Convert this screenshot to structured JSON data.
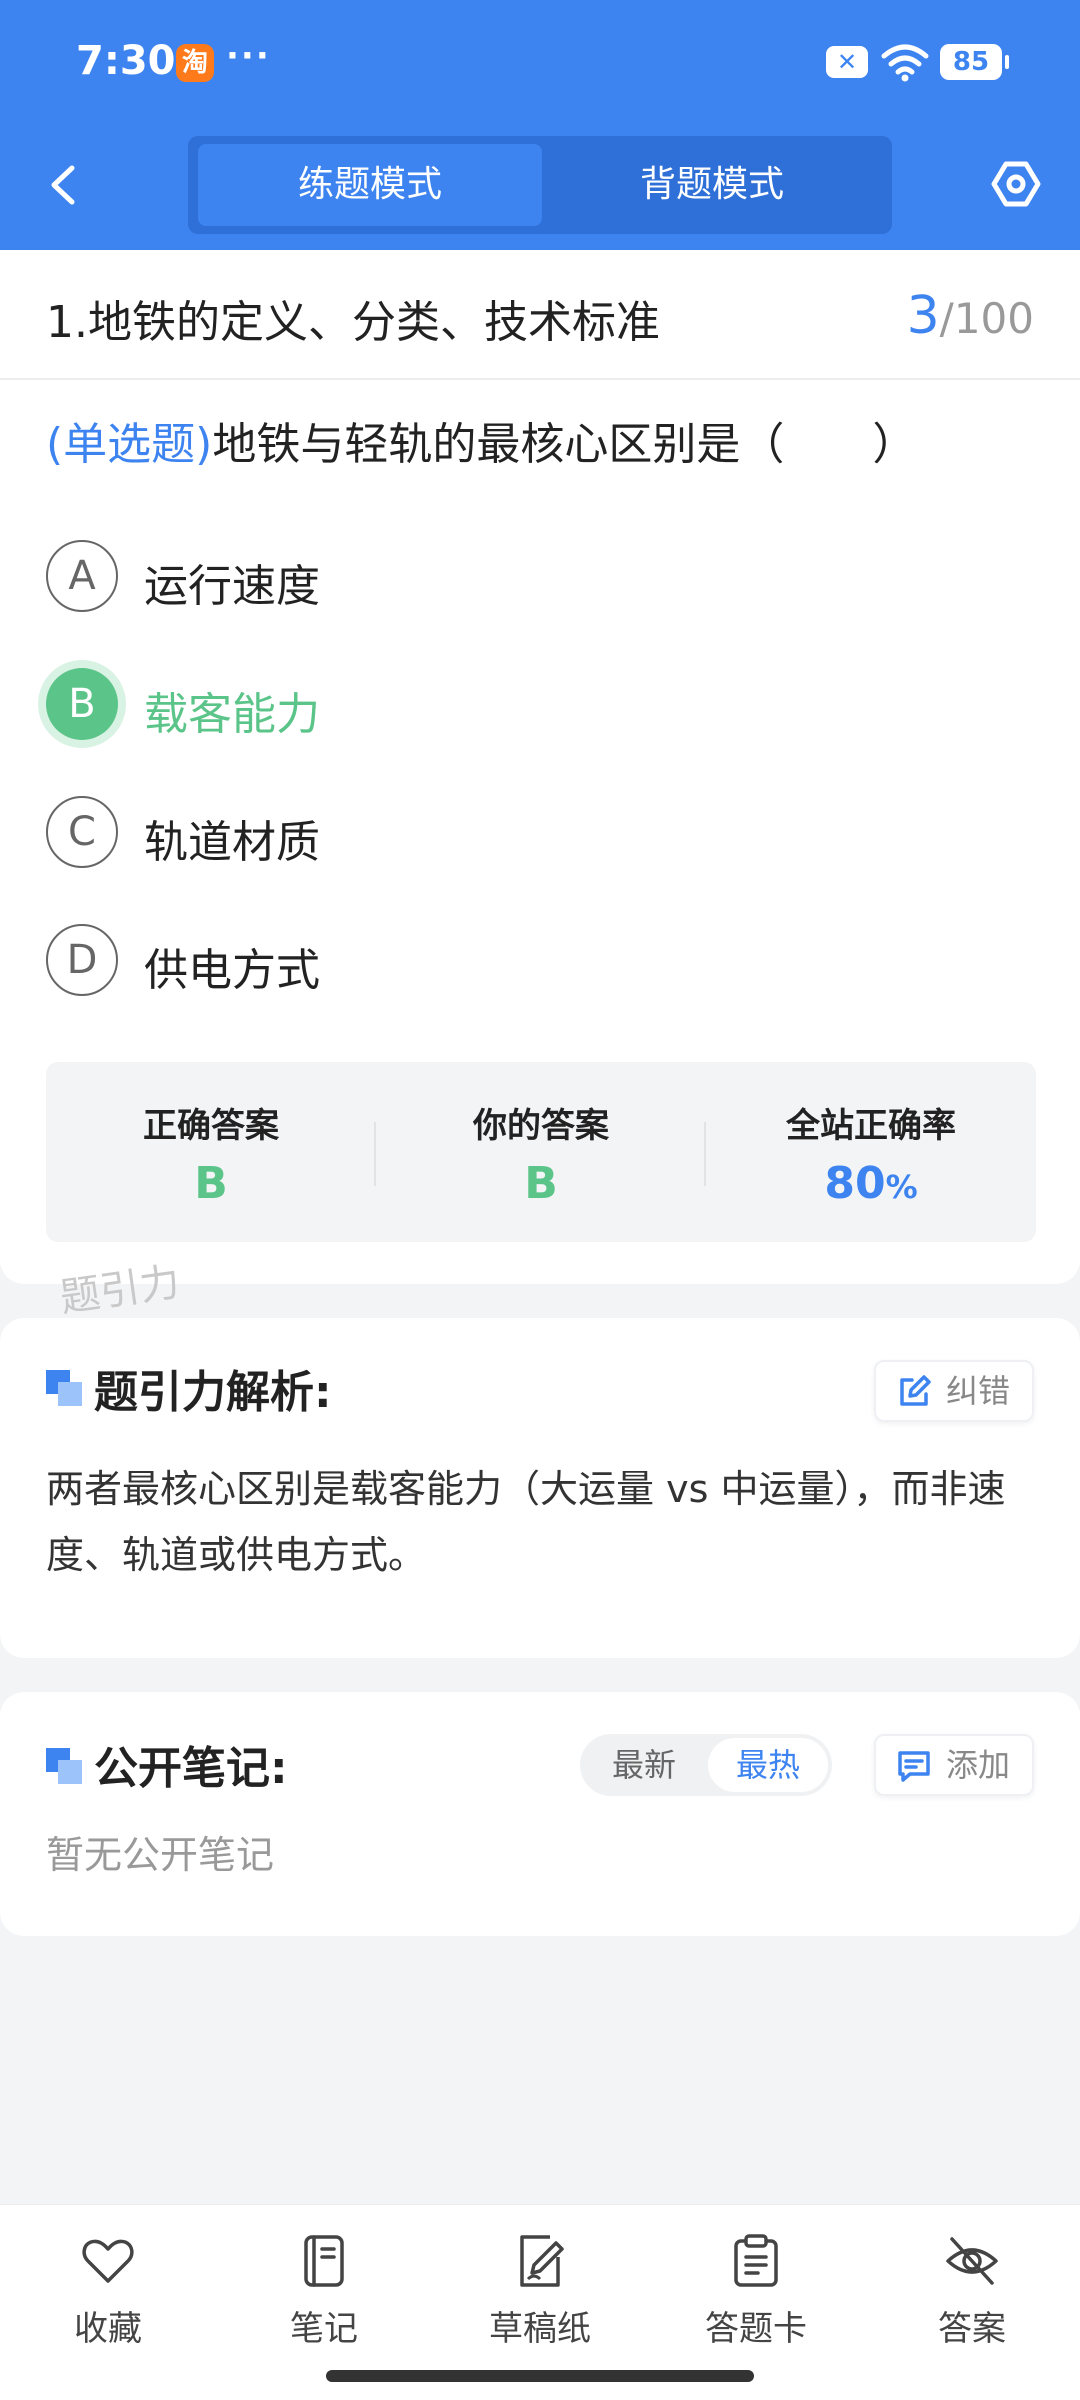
{
  "status_bar": {
    "time": "7:30",
    "app_badge": "淘",
    "dots": "···",
    "battery": "85"
  },
  "header": {
    "modes": [
      "练题模式",
      "背题模式"
    ],
    "active_mode": "练题模式"
  },
  "question": {
    "chapter": "1.地铁的定义、分类、技术标准",
    "current": "3",
    "total": "/100",
    "type": "(单选题)",
    "stem": "地铁与轻轨的最核心区别是（　　）",
    "options": [
      {
        "letter": "A",
        "text": "运行速度",
        "state": "normal"
      },
      {
        "letter": "B",
        "text": "载客能力",
        "state": "correct"
      },
      {
        "letter": "C",
        "text": "轨道材质",
        "state": "normal"
      },
      {
        "letter": "D",
        "text": "供电方式",
        "state": "normal"
      }
    ],
    "result": {
      "correct_label": "正确答案",
      "correct_value": "B",
      "yours_label": "你的答案",
      "yours_value": "B",
      "rate_label": "全站正确率",
      "rate_value": "80",
      "rate_unit": "%"
    }
  },
  "watermark": "题引力",
  "analysis": {
    "title": "题引力解析:",
    "fix_label": "纠错",
    "text": "两者最核心区别是载客能力（大运量 vs 中运量），而非速度、轨道或供电方式。"
  },
  "notes": {
    "title": "公开笔记:",
    "sort_options": [
      "最新",
      "最热"
    ],
    "active_sort": "最热",
    "add_label": "添加",
    "empty_text": "暂无公开笔记"
  },
  "bottom_nav": [
    {
      "label": "收藏",
      "icon": "heart-icon"
    },
    {
      "label": "笔记",
      "icon": "notebook-icon"
    },
    {
      "label": "草稿纸",
      "icon": "draft-paper-icon"
    },
    {
      "label": "答题卡",
      "icon": "answer-sheet-icon"
    },
    {
      "label": "答案",
      "icon": "eye-off-icon"
    }
  ],
  "colors": {
    "primary": "#3d84f0",
    "correct": "#5bc489",
    "background": "#f3f4f6"
  }
}
